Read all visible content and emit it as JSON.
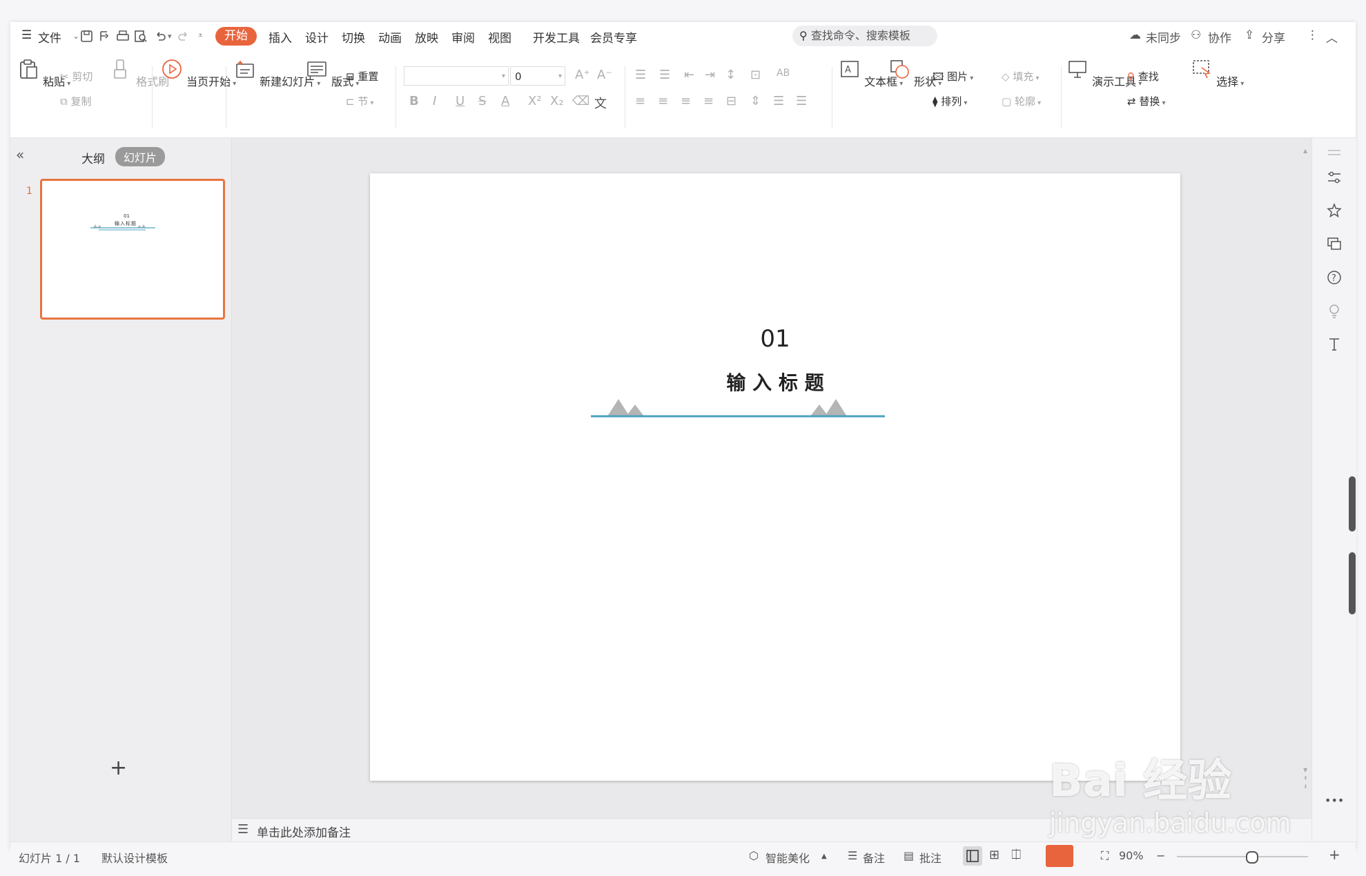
{
  "menubar": {
    "file": "文件",
    "tabs": [
      "开始",
      "插入",
      "设计",
      "切换",
      "动画",
      "放映",
      "审阅",
      "视图",
      "开发工具",
      "会员专享"
    ],
    "search_placeholder": "查找命令、搜索模板",
    "sync": "未同步",
    "collab": "协作",
    "share": "分享"
  },
  "ribbon": {
    "paste": "粘贴",
    "cut": "剪切",
    "copy": "复制",
    "format_painter": "格式刷",
    "slideshow_from_current": "当页开始",
    "new_slide": "新建幻灯片",
    "layout": "版式",
    "reset": "重置",
    "section": "节",
    "font_size": "0",
    "textbox": "文本框",
    "shapes": "形状",
    "picture": "图片",
    "fill": "填充",
    "arrange": "排列",
    "outline": "轮廓",
    "presentation_tools": "演示工具",
    "find": "查找",
    "replace": "替换",
    "select": "选择"
  },
  "left_panel": {
    "outline_tab": "大纲",
    "slides_tab": "幻灯片",
    "slide_number": "1",
    "thumb_num": "01",
    "thumb_title": "输入标题"
  },
  "slide": {
    "number": "01",
    "title": "输 入 标 题",
    "accent_color": "#4aa3c0",
    "mountain_color": "#b5b5b5"
  },
  "notes": {
    "placeholder": "单击此处添加备注"
  },
  "statusbar": {
    "slide_counter": "幻灯片 1 / 1",
    "template": "默认设计模板",
    "beautify": "智能美化",
    "notes": "备注",
    "comments": "批注",
    "zoom": "90%"
  },
  "watermark": {
    "brand": "Bai 经验",
    "url": "jingyan.baidu.com"
  },
  "colors": {
    "accent": "#e8643c",
    "thumb_border": "#e8743e"
  }
}
